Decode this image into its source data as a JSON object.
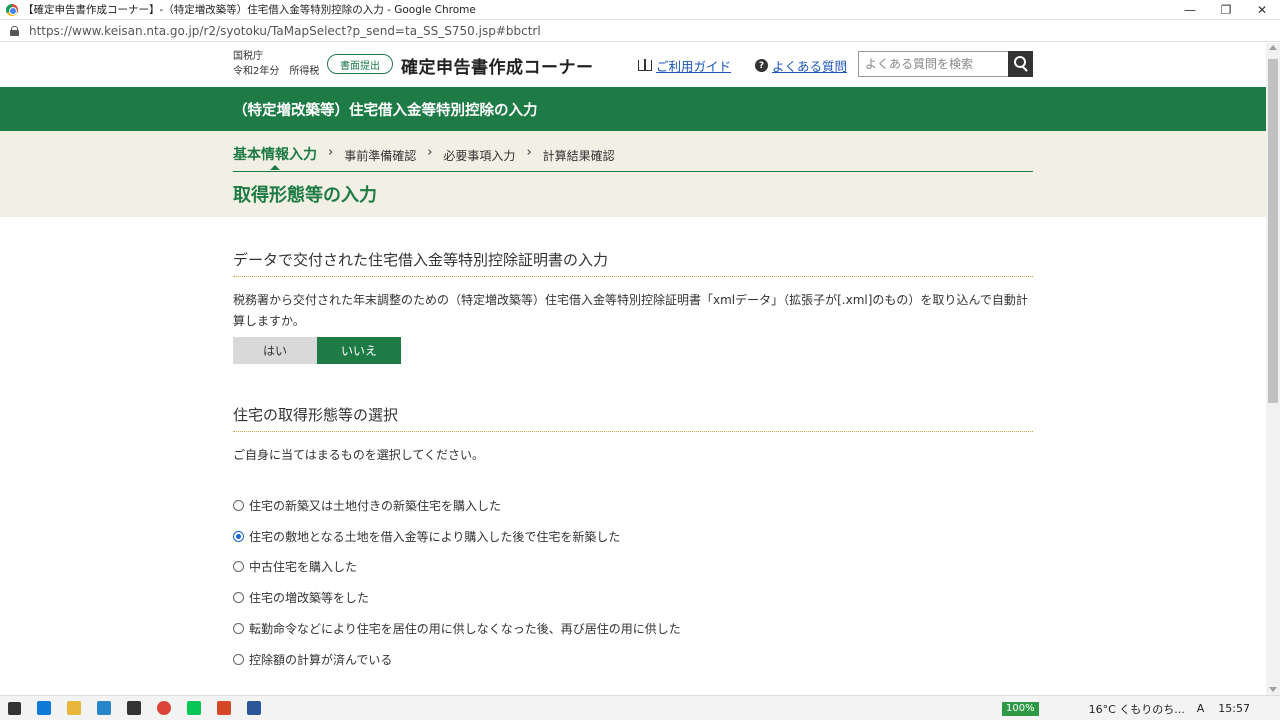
{
  "browser": {
    "window_title": "【確定申告書作成コーナー】-（特定増改築等）住宅借入金等特別控除の入力 - Google Chrome",
    "url": "https://www.keisan.nta.go.jp/r2/syotoku/TaMapSelect?p_send=ta_SS_S750.jsp#bbctrl",
    "controls": {
      "minimize": "—",
      "restore": "❐",
      "close": "✕"
    }
  },
  "header": {
    "agency": "国税庁",
    "year_tax": "令和2年分　所得税",
    "submit_badge": "書面提出",
    "site_title": "確定申告書作成コーナー",
    "guide_label": "ご利用ガイド",
    "faq_icon": "?",
    "faq_label": "よくある質問",
    "search_placeholder": "よくある質問を検索"
  },
  "band_title": "（特定増改築等）住宅借入金等特別控除の入力",
  "steps": [
    {
      "label": "基本情報入力",
      "active": true
    },
    {
      "label": "事前準備確認",
      "active": false
    },
    {
      "label": "必要事項入力",
      "active": false
    },
    {
      "label": "計算結果確認",
      "active": false
    }
  ],
  "step_separator": "›",
  "page_title": "取得形態等の入力",
  "section1": {
    "heading": "データで交付された住宅借入金等特別控除証明書の入力",
    "description": "税務署から交付された年末調整のための（特定増改築等）住宅借入金等特別控除証明書「xmlデータ」（拡張子が[.xml]のもの）を取り込んで自動計算しますか。",
    "yes_label": "はい",
    "no_label": "いいえ",
    "selected": "いいえ"
  },
  "section2": {
    "heading": "住宅の取得形態等の選択",
    "instruction": "ご自身に当てはまるものを選択してください。",
    "options": [
      {
        "label": "住宅の新築又は土地付きの新築住宅を購入した",
        "checked": false
      },
      {
        "label": "住宅の敷地となる土地を借入金等により購入した後で住宅を新築した",
        "checked": true
      },
      {
        "label": "中古住宅を購入した",
        "checked": false
      },
      {
        "label": "住宅の増改築等をした",
        "checked": false
      },
      {
        "label": "転勤命令などにより住宅を居住の用に供しなくなった後、再び居住の用に供した",
        "checked": false
      },
      {
        "label": "控除額の計算が済んでいる",
        "checked": false
      }
    ]
  },
  "taskbar": {
    "battery": "100%",
    "weather": "16°C  くもりのち...",
    "ime": "A",
    "time": "15:57"
  },
  "colors": {
    "accent_green": "#1e7b45",
    "beige": "#f2efe4",
    "link_blue": "#1a55b8"
  }
}
